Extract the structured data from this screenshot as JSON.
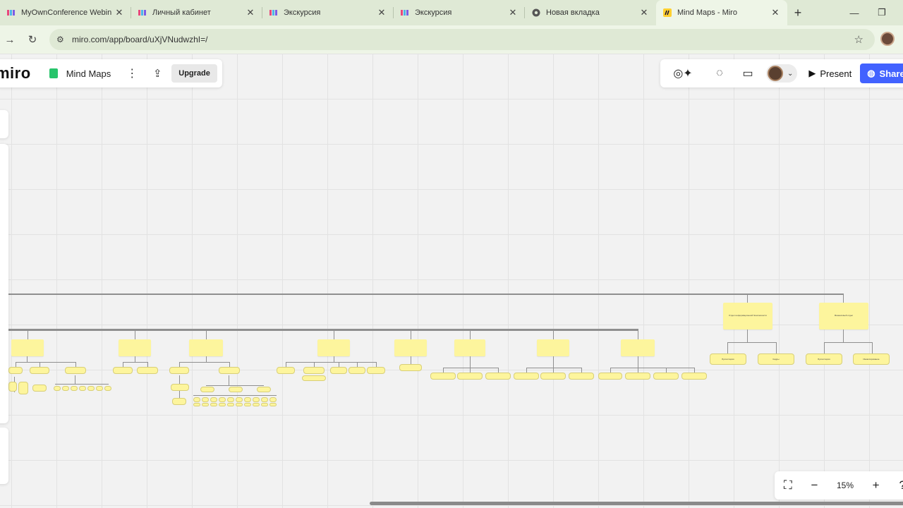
{
  "browser": {
    "tabs": [
      {
        "title": "MyOwnConference Webin",
        "favicon": "miro-m-icon",
        "active": false
      },
      {
        "title": "Личный кабинет",
        "favicon": "miro-m-icon",
        "active": false
      },
      {
        "title": "Экскурсия",
        "favicon": "miro-m-icon",
        "active": false
      },
      {
        "title": "Экскурсия",
        "favicon": "miro-m-icon",
        "active": false
      },
      {
        "title": "Новая вкладка",
        "favicon": "chrome-icon",
        "active": false
      },
      {
        "title": "Mind Maps - Miro",
        "favicon": "miro-logo-icon",
        "active": true
      }
    ],
    "new_tab": "+",
    "url": "miro.com/app/board/uXjVNudwzhI=/"
  },
  "miro": {
    "logo": "miro",
    "board_name": "Mind Maps",
    "upgrade_label": "Upgrade",
    "present_label": "Present",
    "share_label": "Share",
    "zoom_level": "15%"
  },
  "mind_map": {
    "right_branches": [
      "Отдел информационной безопасности",
      "Финансовый отдел"
    ],
    "right_leaves": [
      "Бухгалтерия",
      "Кадры",
      "Бухгалтерия",
      "Инкассирование"
    ]
  },
  "colors": {
    "sticky": "#fdf59d",
    "accent": "#4262ff",
    "tab_bar": "#dfe9d5"
  }
}
